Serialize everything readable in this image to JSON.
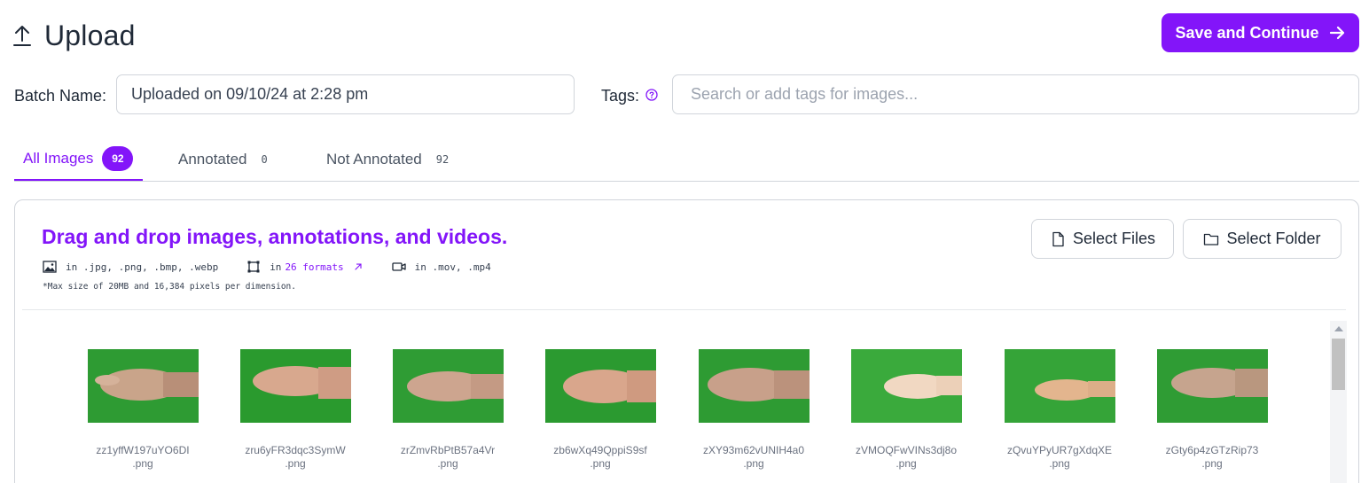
{
  "header": {
    "title": "Upload",
    "upload_icon": "upload-icon",
    "save_label": "Save and Continue",
    "accent": "#8315f9"
  },
  "form": {
    "batch_label": "Batch Name:",
    "batch_value": "Uploaded on 09/10/24 at 2:28 pm",
    "tags_label": "Tags:",
    "tags_placeholder": "Search or add tags for images..."
  },
  "tabs": [
    {
      "label": "All Images",
      "count": "92",
      "active": true
    },
    {
      "label": "Annotated",
      "count": "0",
      "active": false
    },
    {
      "label": "Not Annotated",
      "count": "92",
      "active": false
    }
  ],
  "dropzone": {
    "title": "Drag and drop images, annotations, and videos.",
    "images_formats": "in .jpg, .png, .bmp, .webp",
    "annotations_prefix": "in",
    "annotations_link": "26 formats",
    "video_formats": "in .mov, .mp4",
    "max_note": "*Max size of 20MB and 16,384 pixels per dimension.",
    "select_files": "Select Files",
    "select_folder": "Select Folder"
  },
  "images": [
    {
      "line1": "zz1yffW197uYO6DI",
      "line2": ".png"
    },
    {
      "line1": "zru6yFR3dqc3SymW",
      "line2": ".png"
    },
    {
      "line1": "zrZmvRbPtB57a4Vr",
      "line2": ".png"
    },
    {
      "line1": "zb6wXq49QppiS9sf",
      "line2": ".png"
    },
    {
      "line1": "zXY93m62vUNIH4a0",
      "line2": ".png"
    },
    {
      "line1": "zVMOQFwVINs3dj8o",
      "line2": ".png"
    },
    {
      "line1": "zQvuYPyUR7gXdqXE",
      "line2": ".png"
    },
    {
      "line1": "zGty6p4zGTzRip73",
      "line2": ".png"
    }
  ]
}
